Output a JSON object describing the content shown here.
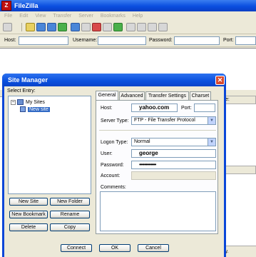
{
  "app": {
    "title": "FileZilla"
  },
  "menu": [
    "File",
    "Edit",
    "View",
    "Transfer",
    "Server",
    "Bookmarks",
    "Help"
  ],
  "quickconnect": {
    "host_label": "Host:",
    "username_label": "Username:",
    "password_label": "Password:",
    "port_label": "Port:"
  },
  "background": {
    "right_header_fragment": "te:",
    "name_header_fragment": "/e",
    "status_fragment": "ctory."
  },
  "dialog": {
    "title": "Site Manager",
    "select_entry_label": "Select Entry:",
    "tree": {
      "root": "My Sites",
      "child": "New site"
    },
    "buttons": {
      "new_site": "New Site",
      "new_folder": "New Folder",
      "new_bookmark": "New Bookmark",
      "rename": "Rename",
      "delete": "Delete",
      "copy": "Copy",
      "connect": "Connect",
      "ok": "OK",
      "cancel": "Cancel"
    },
    "tabs": [
      "General",
      "Advanced",
      "Transfer Settings",
      "Charset"
    ],
    "general": {
      "host_label": "Host:",
      "host_value": "yahoo.com",
      "port_label": "Port:",
      "port_value": "",
      "server_type_label": "Server Type:",
      "server_type_value": "FTP - File Transfer Protocol",
      "logon_type_label": "Logon Type:",
      "logon_type_value": "Normal",
      "user_label": "User:",
      "user_value": "george",
      "password_label": "Password:",
      "password_value": "•••••••••••••",
      "account_label": "Account:",
      "account_value": "",
      "comments_label": "Comments:"
    }
  },
  "colors": {
    "titlebar": "#0a4ee0",
    "selection": "#316ac5",
    "close": "#d84a2e"
  }
}
